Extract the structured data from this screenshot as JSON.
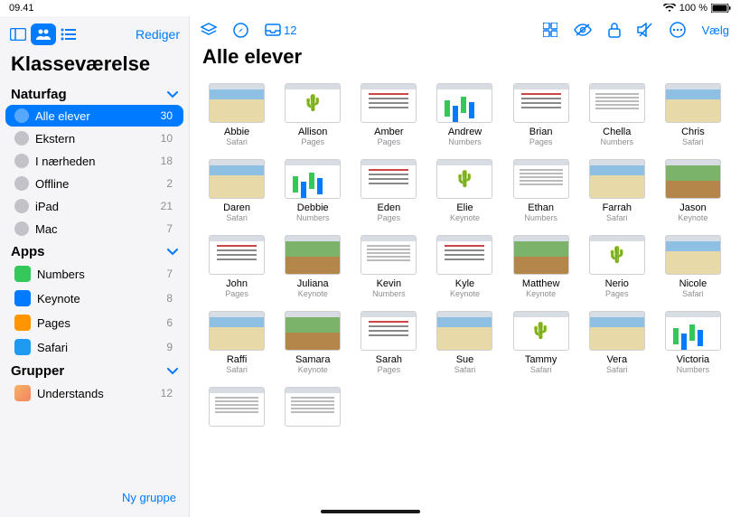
{
  "statusbar": {
    "time": "09.41",
    "battery": "100 %"
  },
  "sidebar": {
    "edit": "Rediger",
    "title": "Klasseværelse",
    "sections": [
      {
        "label": "Naturfag"
      },
      {
        "label": "Apps"
      },
      {
        "label": "Grupper"
      }
    ],
    "class_items": [
      {
        "label": "Alle elever",
        "count": "30",
        "selected": true
      },
      {
        "label": "Ekstern",
        "count": "10"
      },
      {
        "label": "I nærheden",
        "count": "18"
      },
      {
        "label": "Offline",
        "count": "2"
      },
      {
        "label": "iPad",
        "count": "21"
      },
      {
        "label": "Mac",
        "count": "7"
      }
    ],
    "app_items": [
      {
        "label": "Numbers",
        "count": "7",
        "color": "#34c759"
      },
      {
        "label": "Keynote",
        "count": "8",
        "color": "#007aff"
      },
      {
        "label": "Pages",
        "count": "6",
        "color": "#ff9500"
      },
      {
        "label": "Safari",
        "count": "9",
        "color": "#1e9bf0"
      }
    ],
    "group_items": [
      {
        "label": "Understands",
        "count": "12"
      }
    ],
    "new_group": "Ny gruppe"
  },
  "toolbar": {
    "inbox_count": "12",
    "select": "Vælg"
  },
  "main": {
    "title": "Alle elever",
    "students": [
      {
        "name": "Abbie",
        "app": "Safari",
        "t": "map"
      },
      {
        "name": "Allison",
        "app": "Pages",
        "t": "plant"
      },
      {
        "name": "Amber",
        "app": "Pages",
        "t": "doc"
      },
      {
        "name": "Andrew",
        "app": "Numbers",
        "t": "chart"
      },
      {
        "name": "Brian",
        "app": "Pages",
        "t": "doc"
      },
      {
        "name": "Chella",
        "app": "Numbers",
        "t": "text"
      },
      {
        "name": "Chris",
        "app": "Safari",
        "t": "map"
      },
      {
        "name": "Daren",
        "app": "Safari",
        "t": "map"
      },
      {
        "name": "Debbie",
        "app": "Numbers",
        "t": "chart"
      },
      {
        "name": "Eden",
        "app": "Pages",
        "t": "doc"
      },
      {
        "name": "Elie",
        "app": "Keynote",
        "t": "plant"
      },
      {
        "name": "Ethan",
        "app": "Numbers",
        "t": "text"
      },
      {
        "name": "Farrah",
        "app": "Safari",
        "t": "map"
      },
      {
        "name": "Jason",
        "app": "Keynote",
        "t": "soil"
      },
      {
        "name": "John",
        "app": "Pages",
        "t": "doc"
      },
      {
        "name": "Juliana",
        "app": "Keynote",
        "t": "soil"
      },
      {
        "name": "Kevin",
        "app": "Numbers",
        "t": "text"
      },
      {
        "name": "Kyle",
        "app": "Keynote",
        "t": "doc"
      },
      {
        "name": "Matthew",
        "app": "Keynote",
        "t": "soil"
      },
      {
        "name": "Nerio",
        "app": "Pages",
        "t": "plant"
      },
      {
        "name": "Nicole",
        "app": "Safari",
        "t": "map"
      },
      {
        "name": "Raffi",
        "app": "Safari",
        "t": "map"
      },
      {
        "name": "Samara",
        "app": "Keynote",
        "t": "soil"
      },
      {
        "name": "Sarah",
        "app": "Pages",
        "t": "doc"
      },
      {
        "name": "Sue",
        "app": "Safari",
        "t": "map"
      },
      {
        "name": "Tammy",
        "app": "Safari",
        "t": "plant"
      },
      {
        "name": "Vera",
        "app": "Safari",
        "t": "map"
      },
      {
        "name": "Victoria",
        "app": "Numbers",
        "t": "chart"
      },
      {
        "name": "",
        "app": "",
        "t": "text"
      },
      {
        "name": "",
        "app": "",
        "t": "text"
      }
    ]
  }
}
